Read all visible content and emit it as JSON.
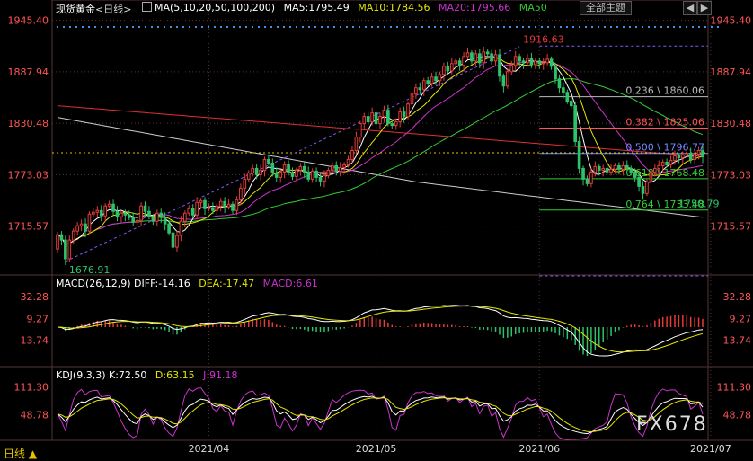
{
  "header": {
    "symbol": "现货黄金",
    "period_tag": "<日线>",
    "ma_label": "MA(5,10,20,50,100,200)",
    "ma5": "MA5:1795.49",
    "ma10": "MA10:1784.56",
    "ma20": "MA20:1795.66",
    "ma50": "MA50",
    "theme_button": "全部主题",
    "nav_left": "◀",
    "nav_right": "▶"
  },
  "macd_header": {
    "label": "MACD(26,12,9)",
    "diff": "DIFF:-14.16",
    "dea": "DEA:-17.47",
    "macd": "MACD:6.61"
  },
  "kdj_header": {
    "label": "KDJ(9,3,3)",
    "k": "K:72.50",
    "d": "D:63.15",
    "j": "J:91.18"
  },
  "footer": {
    "period": "日线 ▲",
    "watermark": "FX678"
  },
  "colors": {
    "up": "#e83a3a",
    "down": "#2ec26b",
    "ma5": "#ffffff",
    "ma10": "#e6e600",
    "ma20": "#cc33cc",
    "ma50": "#33cc33",
    "ma100": "#cccccc",
    "ma200": "#e03030",
    "axis": "#ff5555",
    "grid": "#553333"
  },
  "chart_data": [
    {
      "type": "candlestick",
      "title": "现货黄金 <日线>",
      "price_ticks": [
        1945.4,
        1887.94,
        1830.48,
        1773.03,
        1715.57
      ],
      "ylim": [
        1665,
        1950
      ],
      "x_ticks": [
        "2021/04",
        "2021/05",
        "2021/06",
        "2021/07"
      ],
      "x_tick_index": [
        38,
        80,
        121,
        164
      ],
      "candles": [
        [
          1690,
          1706
        ],
        [
          1706,
          1700
        ],
        [
          1700,
          1679
        ],
        [
          1679,
          1700
        ],
        [
          1700,
          1710
        ],
        [
          1710,
          1716
        ],
        [
          1716,
          1718
        ],
        [
          1718,
          1710
        ],
        [
          1710,
          1729
        ],
        [
          1729,
          1731
        ],
        [
          1731,
          1733
        ],
        [
          1733,
          1727
        ],
        [
          1727,
          1738
        ],
        [
          1738,
          1740
        ],
        [
          1740,
          1732
        ],
        [
          1732,
          1726
        ],
        [
          1726,
          1730
        ],
        [
          1730,
          1728
        ],
        [
          1728,
          1725
        ],
        [
          1725,
          1720
        ],
        [
          1720,
          1722
        ],
        [
          1722,
          1738
        ],
        [
          1738,
          1732
        ],
        [
          1732,
          1726
        ],
        [
          1726,
          1721
        ],
        [
          1721,
          1730
        ],
        [
          1730,
          1725
        ],
        [
          1725,
          1718
        ],
        [
          1718,
          1708
        ],
        [
          1708,
          1692
        ],
        [
          1692,
          1705
        ],
        [
          1705,
          1721
        ],
        [
          1721,
          1730
        ],
        [
          1730,
          1735
        ],
        [
          1735,
          1728
        ],
        [
          1728,
          1742
        ],
        [
          1742,
          1744
        ],
        [
          1744,
          1735
        ],
        [
          1735,
          1736
        ],
        [
          1736,
          1733
        ],
        [
          1733,
          1738
        ],
        [
          1738,
          1743
        ],
        [
          1743,
          1737
        ],
        [
          1737,
          1740
        ],
        [
          1740,
          1733
        ],
        [
          1733,
          1745
        ],
        [
          1745,
          1758
        ],
        [
          1758,
          1768
        ],
        [
          1768,
          1775
        ],
        [
          1775,
          1780
        ],
        [
          1780,
          1773
        ],
        [
          1773,
          1778
        ],
        [
          1778,
          1790
        ],
        [
          1790,
          1786
        ],
        [
          1786,
          1775
        ],
        [
          1775,
          1770
        ],
        [
          1770,
          1776
        ],
        [
          1776,
          1784
        ],
        [
          1784,
          1775
        ],
        [
          1775,
          1771
        ],
        [
          1771,
          1778
        ],
        [
          1778,
          1782
        ],
        [
          1782,
          1776
        ],
        [
          1776,
          1768
        ],
        [
          1768,
          1777
        ],
        [
          1777,
          1770
        ],
        [
          1770,
          1766
        ],
        [
          1766,
          1772
        ],
        [
          1772,
          1778
        ],
        [
          1778,
          1783
        ],
        [
          1783,
          1777
        ],
        [
          1777,
          1781
        ],
        [
          1781,
          1784
        ],
        [
          1784,
          1790
        ],
        [
          1790,
          1800
        ],
        [
          1800,
          1815
        ],
        [
          1815,
          1830
        ],
        [
          1830,
          1838
        ],
        [
          1838,
          1832
        ],
        [
          1832,
          1842
        ],
        [
          1842,
          1830
        ],
        [
          1830,
          1838
        ],
        [
          1838,
          1845
        ],
        [
          1845,
          1830
        ],
        [
          1830,
          1828
        ],
        [
          1828,
          1832
        ],
        [
          1832,
          1843
        ],
        [
          1843,
          1838
        ],
        [
          1838,
          1852
        ],
        [
          1852,
          1863
        ],
        [
          1863,
          1870
        ],
        [
          1870,
          1868
        ],
        [
          1868,
          1878
        ],
        [
          1878,
          1875
        ],
        [
          1875,
          1882
        ],
        [
          1882,
          1878
        ],
        [
          1878,
          1885
        ],
        [
          1885,
          1894
        ],
        [
          1894,
          1889
        ],
        [
          1889,
          1897
        ],
        [
          1897,
          1900
        ],
        [
          1900,
          1895
        ],
        [
          1895,
          1905
        ],
        [
          1905,
          1909
        ],
        [
          1909,
          1900
        ],
        [
          1900,
          1908
        ],
        [
          1908,
          1898
        ],
        [
          1898,
          1910
        ],
        [
          1910,
          1908
        ],
        [
          1908,
          1900
        ],
        [
          1900,
          1907
        ],
        [
          1907,
          1883
        ],
        [
          1883,
          1872
        ],
        [
          1872,
          1888
        ],
        [
          1888,
          1895
        ],
        [
          1895,
          1905
        ],
        [
          1905,
          1900
        ],
        [
          1900,
          1898
        ],
        [
          1898,
          1903
        ],
        [
          1903,
          1896
        ],
        [
          1896,
          1900
        ],
        [
          1900,
          1897
        ],
        [
          1897,
          1898
        ],
        [
          1898,
          1902
        ],
        [
          1902,
          1894
        ],
        [
          1894,
          1880
        ],
        [
          1880,
          1870
        ],
        [
          1870,
          1865
        ],
        [
          1865,
          1855
        ],
        [
          1855,
          1850
        ],
        [
          1850,
          1810
        ],
        [
          1810,
          1780
        ],
        [
          1780,
          1768
        ],
        [
          1768,
          1763
        ],
        [
          1763,
          1776
        ],
        [
          1776,
          1782
        ],
        [
          1782,
          1778
        ],
        [
          1778,
          1780
        ],
        [
          1780,
          1776
        ],
        [
          1776,
          1779
        ],
        [
          1779,
          1783
        ],
        [
          1783,
          1779
        ],
        [
          1779,
          1783
        ],
        [
          1783,
          1780
        ],
        [
          1780,
          1776
        ],
        [
          1776,
          1770
        ],
        [
          1770,
          1760
        ],
        [
          1760,
          1752
        ],
        [
          1752,
          1765
        ],
        [
          1765,
          1776
        ],
        [
          1776,
          1780
        ],
        [
          1780,
          1783
        ],
        [
          1783,
          1787
        ],
        [
          1787,
          1784
        ],
        [
          1784,
          1789
        ],
        [
          1789,
          1794
        ],
        [
          1794,
          1792
        ],
        [
          1792,
          1795
        ],
        [
          1795,
          1797
        ],
        [
          1797,
          1790
        ],
        [
          1790,
          1796
        ],
        [
          1796,
          1800
        ],
        [
          1800,
          1793
        ]
      ],
      "annotations": [
        {
          "label": "1916.63",
          "price": 1916.63,
          "index": 116
        },
        {
          "label": "1676.91",
          "price": 1676.91,
          "index": 2
        },
        {
          "label": "1750.79",
          "price": 1750.79,
          "index": 155
        }
      ],
      "fibonacci": [
        {
          "label": "0.236 \\ 1860.06",
          "price": 1860.06,
          "color": "#bbbbbb"
        },
        {
          "label": "0.382 \\ 1825.06",
          "price": 1825.06,
          "color": "#ff5555"
        },
        {
          "label": "0.500 \\ 1796.77",
          "price": 1796.77,
          "color": "#7788ff"
        },
        {
          "label": "0.618 \\ 1768.48",
          "price": 1768.48,
          "color": "#33cc33"
        },
        {
          "label": "0.764 \\ 1733.48",
          "price": 1733.48,
          "color": "#33cc33"
        }
      ],
      "fib_bounds": [
        1916.63,
        1676.91
      ],
      "current_price": 1797.5
    },
    {
      "type": "bar",
      "title": "MACD(26,12,9)",
      "y_ticks": [
        32.28,
        9.27,
        -13.74
      ],
      "ylim": [
        -40,
        40
      ]
    },
    {
      "type": "line",
      "title": "KDJ(9,3,3)",
      "y_ticks": [
        111.3,
        48.78
      ],
      "ylim": [
        -10,
        125
      ]
    }
  ]
}
